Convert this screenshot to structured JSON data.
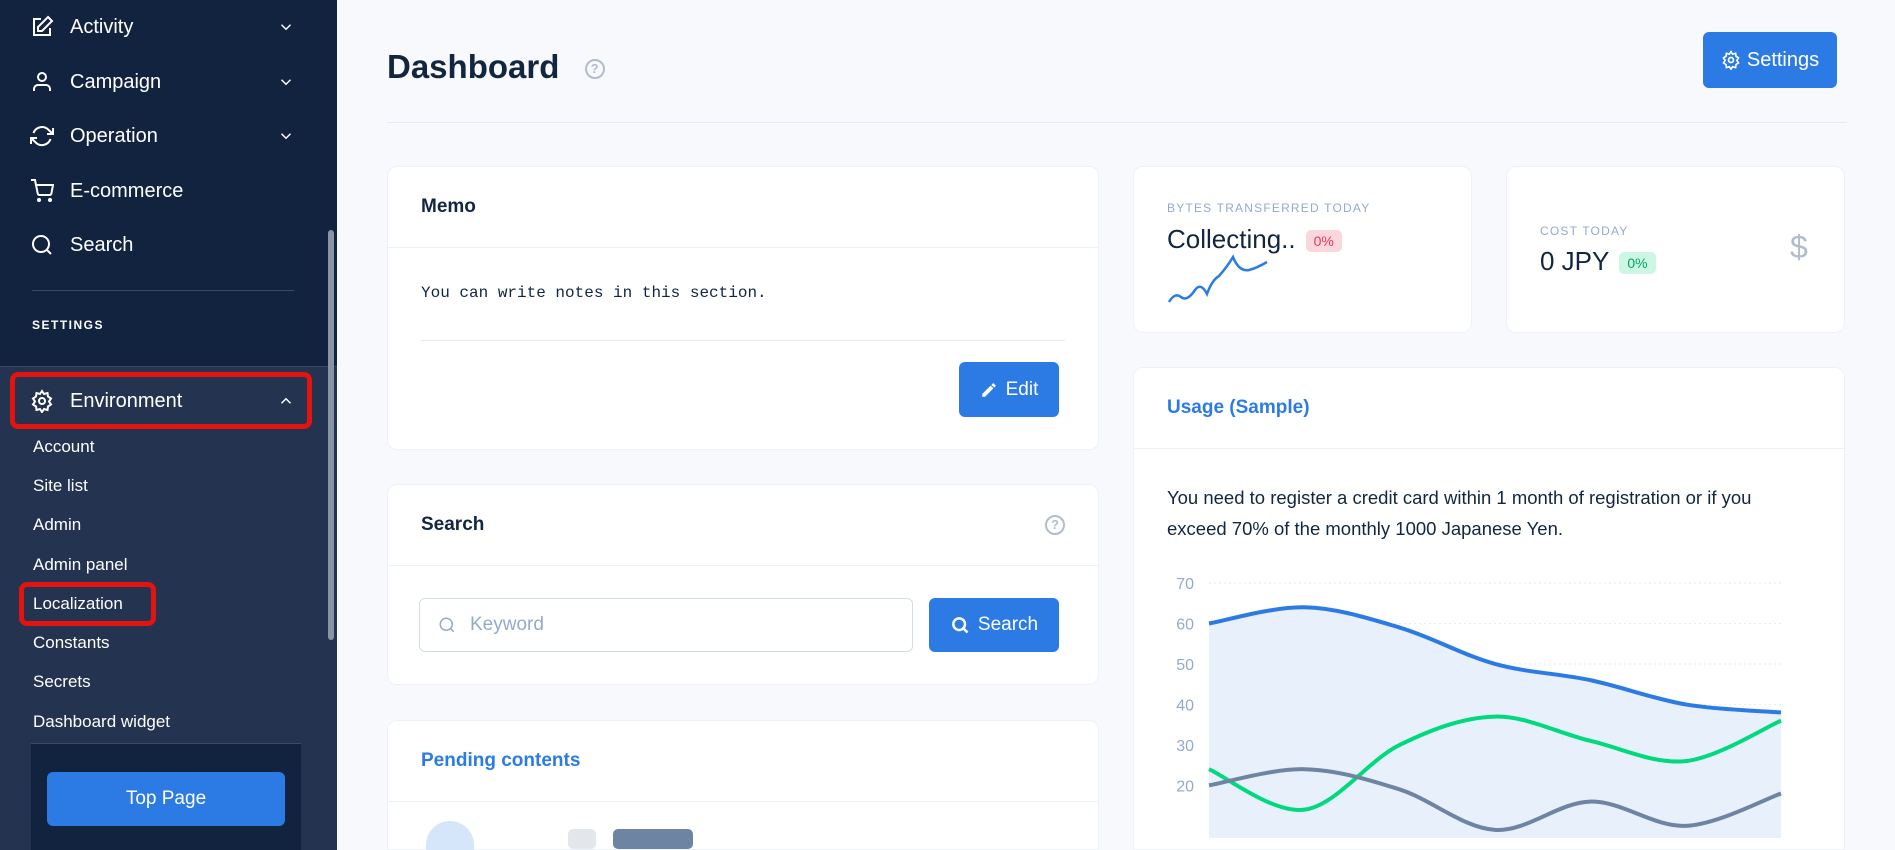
{
  "sidebar": {
    "items": [
      {
        "label": "Activity",
        "icon": "edit-icon"
      },
      {
        "label": "Campaign",
        "icon": "user-icon"
      },
      {
        "label": "Operation",
        "icon": "refresh-icon"
      },
      {
        "label": "E-commerce",
        "icon": "cart-icon"
      },
      {
        "label": "Search",
        "icon": "search-icon"
      }
    ],
    "section": "SETTINGS",
    "environment": "Environment",
    "subitems": [
      "Account",
      "Site list",
      "Admin",
      "Admin panel",
      "Localization",
      "Constants",
      "Secrets",
      "Dashboard widget"
    ],
    "top_page": "Top Page"
  },
  "header": {
    "title": "Dashboard",
    "help": "?",
    "settings": "Settings"
  },
  "memo": {
    "title": "Memo",
    "text": "You can write notes in this section.",
    "edit": "Edit"
  },
  "search": {
    "title": "Search",
    "placeholder": "Keyword",
    "button": "Search",
    "help": "?"
  },
  "pending": {
    "title": "Pending contents"
  },
  "bytes": {
    "label": "BYTES TRANSFERRED TODAY",
    "value": "Collecting..",
    "badge": "0%"
  },
  "cost": {
    "label": "COST TODAY",
    "value": "0 JPY",
    "badge": "0%",
    "icon": "$"
  },
  "usage": {
    "title": "Usage (Sample)",
    "text": "You need to register a credit card within 1 month of registration or if you exceed 70% of the monthly 1000 Japanese Yen."
  },
  "colors": {
    "accent": "#2c7be5",
    "green": "#00d97e",
    "grey": "#6e84a3",
    "sidebar": "#12233f"
  },
  "chart_data": {
    "type": "line",
    "yticks": [
      "70",
      "60",
      "50",
      "40",
      "30",
      "20"
    ],
    "ylim": [
      10,
      70
    ],
    "grid": true,
    "series": [
      {
        "values": [
          60,
          64,
          59,
          50,
          46,
          40,
          38
        ],
        "color": "#2c7be5",
        "fill": true
      },
      {
        "values": [
          24,
          14,
          30,
          37,
          31,
          26,
          36
        ],
        "color": "#00d97e"
      },
      {
        "values": [
          20,
          24,
          19,
          9,
          16,
          10,
          18
        ],
        "color": "#6e84a3"
      }
    ]
  }
}
